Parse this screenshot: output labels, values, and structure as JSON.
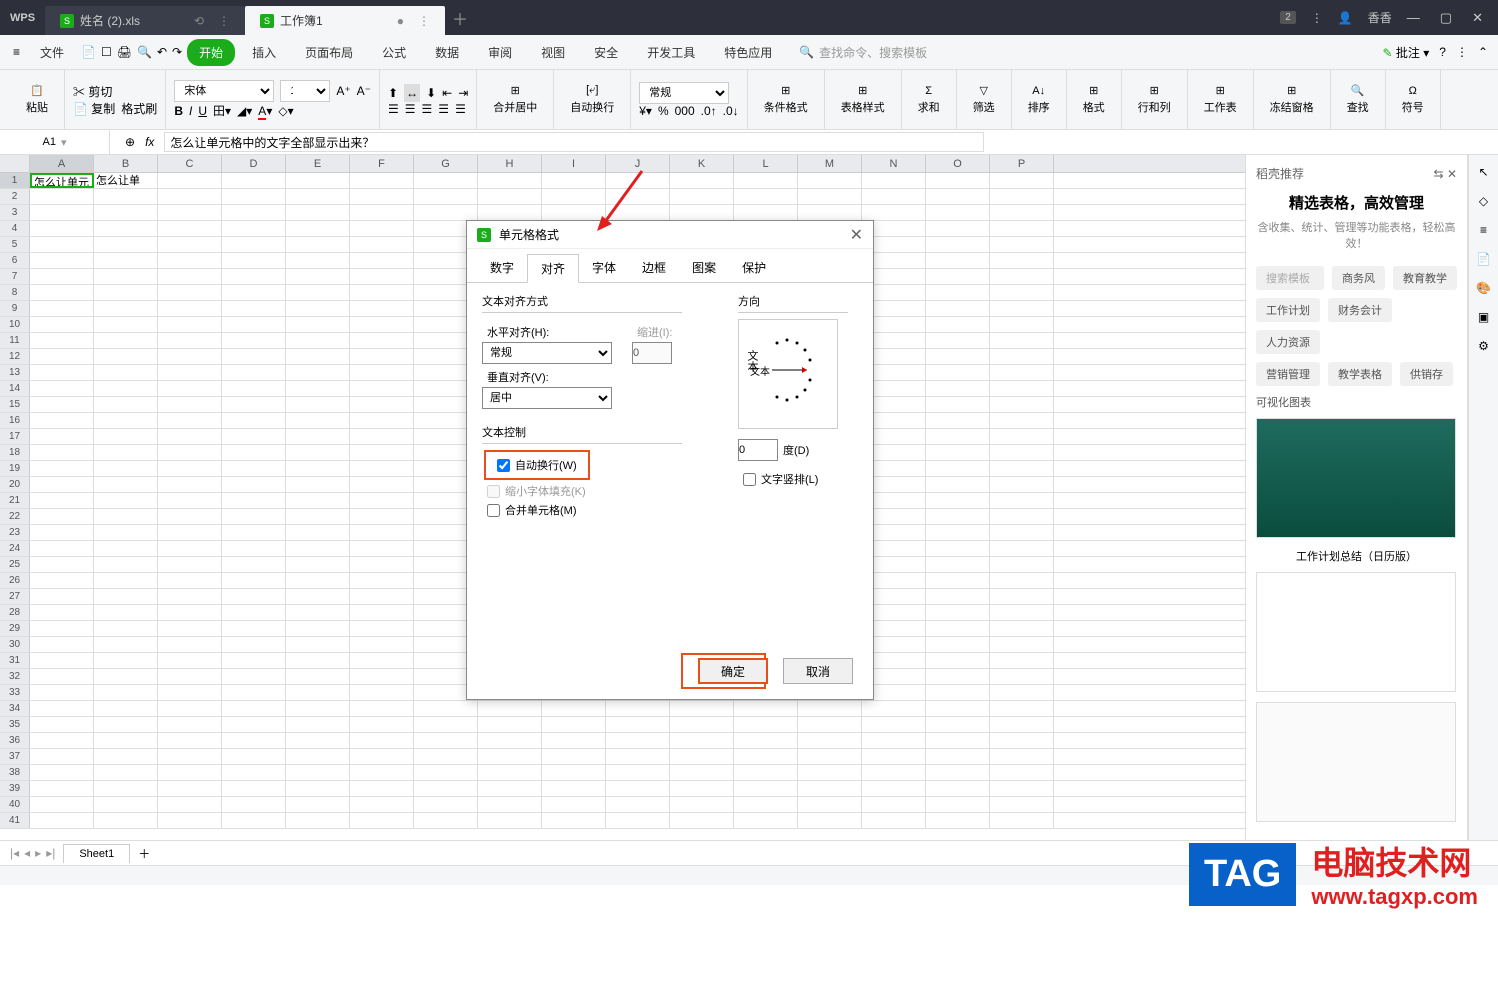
{
  "titlebar": {
    "app": "WPS",
    "tab1": "姓名 (2).xls",
    "tab2": "工作簿1",
    "user": "香香"
  },
  "menu": {
    "file": "文件",
    "start": "开始",
    "insert": "插入",
    "layout": "页面布局",
    "formula": "公式",
    "data": "数据",
    "review": "审阅",
    "view": "视图",
    "safety": "安全",
    "dev": "开发工具",
    "special": "特色应用",
    "search": "查找命令、搜索模板",
    "annotate": "批注"
  },
  "ribbon": {
    "paste": "粘贴",
    "cut": "剪切",
    "copy": "复制",
    "fmtpaint": "格式刷",
    "font": "宋体",
    "fontsize": "11",
    "mergecenter": "合并居中",
    "autowrap": "自动换行",
    "numfmt": "常规",
    "condfmt": "条件格式",
    "tablestyle": "表格样式",
    "sum": "求和",
    "filter": "筛选",
    "sort": "排序",
    "format": "格式",
    "rows": "行和列",
    "worksheet": "工作表",
    "freeze": "冻结窗格",
    "find": "查找",
    "symbol": "符号"
  },
  "formula": {
    "cell": "A1",
    "content": "怎么让单元格中的文字全部显示出来？"
  },
  "grid": {
    "cols": [
      "A",
      "B",
      "C",
      "D",
      "E",
      "F",
      "G",
      "H",
      "I",
      "J",
      "K",
      "L",
      "M",
      "N",
      "O",
      "P"
    ],
    "a1": "怎么让单元",
    "b1": "怎么让单",
    "rowcount": 41
  },
  "panel": {
    "header": "稻壳推荐",
    "title": "精选表格，高效管理",
    "subtitle": "含收集、统计、管理等功能表格，轻松高效！",
    "search_ph": "搜索模板",
    "tags": [
      "商务风",
      "教育教学",
      "工作计划",
      "财务会计",
      "人力资源",
      "营销管理",
      "教学表格",
      "供销存",
      "可视化图表"
    ],
    "template2_title": "工作计划总结（日历版）"
  },
  "dialog": {
    "title": "单元格格式",
    "tabs": {
      "num": "数字",
      "align": "对齐",
      "font": "字体",
      "border": "边框",
      "pattern": "图案",
      "protect": "保护"
    },
    "align_section": "文本对齐方式",
    "halign_label": "水平对齐(H):",
    "halign_value": "常规",
    "indent_label": "缩进(I):",
    "indent_value": "0",
    "valign_label": "垂直对齐(V):",
    "valign_value": "居中",
    "control_section": "文本控制",
    "wrap": "自动换行(W)",
    "shrink": "缩小字体填充(K)",
    "merge": "合并单元格(M)",
    "orient_section": "方向",
    "orient_text1": "文本",
    "orient_text2": "文本",
    "degree_value": "0",
    "degree_label": "度(D)",
    "vertical_text": "文字竖排(L)",
    "ok": "确定",
    "cancel": "取消"
  },
  "sheet": {
    "name": "Sheet1"
  },
  "watermark": {
    "tag": "TAG",
    "cn": "电脑技术网",
    "url": "www.tagxp.com"
  }
}
